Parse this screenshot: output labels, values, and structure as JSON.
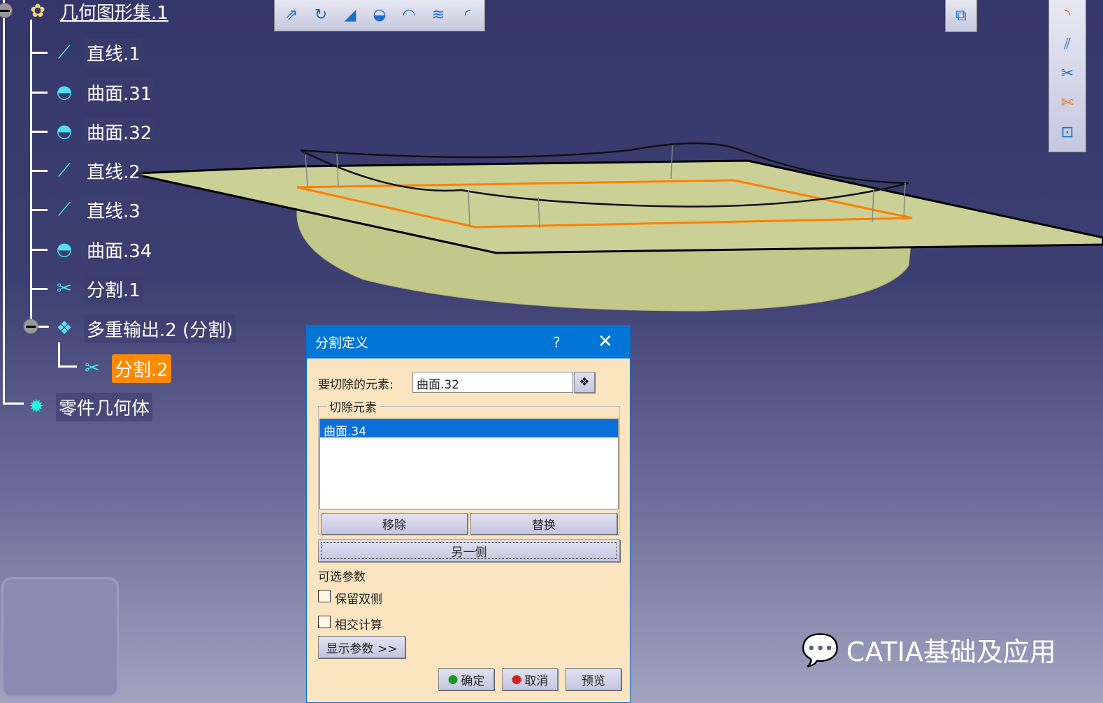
{
  "tree": {
    "root": "几何图形集.1",
    "items": [
      {
        "label": "直线.1",
        "icon": "line-icon"
      },
      {
        "label": "曲面.31",
        "icon": "surface-icon"
      },
      {
        "label": "曲面.32",
        "icon": "surface-icon"
      },
      {
        "label": "直线.2",
        "icon": "line-icon"
      },
      {
        "label": "直线.3",
        "icon": "line-icon"
      },
      {
        "label": "曲面.34",
        "icon": "surface-icon"
      },
      {
        "label": "分割.1",
        "icon": "split-icon"
      }
    ],
    "multi_output": "多重输出.2 (分割)",
    "selected_child": "分割.2",
    "body": "零件几何体"
  },
  "dialog": {
    "title": "分割定义",
    "help": "?",
    "close": "✕",
    "element_to_cut_label": "要切除的元素:",
    "element_to_cut_value": "曲面.32",
    "cutting_elements_group": "切除元素",
    "cutting_elements": [
      "曲面.34"
    ],
    "remove": "移除",
    "replace": "替换",
    "other_side": "另一侧",
    "optional_params": "可选参数",
    "keep_both_sides": "保留双侧",
    "keep_both_checked": false,
    "intersection_compute": "相交计算",
    "intersection_checked": false,
    "show_params": "显示参数 >>",
    "ok": "确定",
    "cancel": "取消",
    "preview": "预览"
  },
  "watermark": "CATIA基础及应用",
  "colors": {
    "selection": "#ff8a00",
    "dialog_title": "#0176d6",
    "surface": "#c9cf8f",
    "cut_edge": "#ff7f00"
  }
}
